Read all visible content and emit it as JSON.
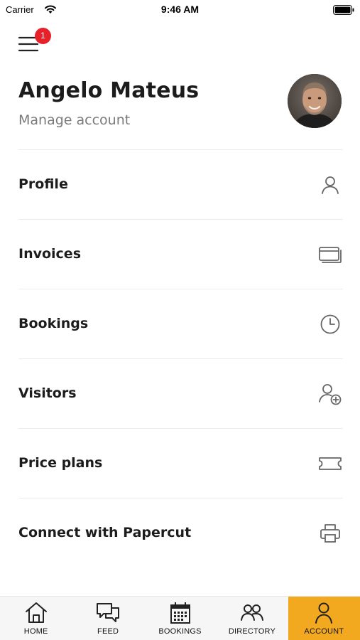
{
  "status_bar": {
    "carrier": "Carrier",
    "time": "9:46 AM"
  },
  "menu": {
    "icon": "hamburger-icon",
    "badge_count": "1"
  },
  "header": {
    "name": "Angelo Mateus",
    "manage_label": "Manage account",
    "avatar": "user-avatar-photo"
  },
  "items": [
    {
      "label": "Profile",
      "icon": "person-icon"
    },
    {
      "label": "Invoices",
      "icon": "cards-icon"
    },
    {
      "label": "Bookings",
      "icon": "clock-icon"
    },
    {
      "label": "Visitors",
      "icon": "person-add-icon"
    },
    {
      "label": "Price plans",
      "icon": "ticket-icon"
    },
    {
      "label": "Connect with Papercut",
      "icon": "printer-icon"
    }
  ],
  "tabs": [
    {
      "label": "HOME",
      "icon": "home-icon",
      "active": false
    },
    {
      "label": "FEED",
      "icon": "chat-bubbles-icon",
      "active": false
    },
    {
      "label": "BOOKINGS",
      "icon": "calendar-icon",
      "active": false
    },
    {
      "label": "DIRECTORY",
      "icon": "people-icon",
      "active": false
    },
    {
      "label": "ACCOUNT",
      "icon": "person-icon",
      "active": true
    }
  ],
  "colors": {
    "accent": "#f2a91f",
    "badge": "#e8202a",
    "text": "#1c1c1c",
    "muted": "#7a7a7a"
  }
}
